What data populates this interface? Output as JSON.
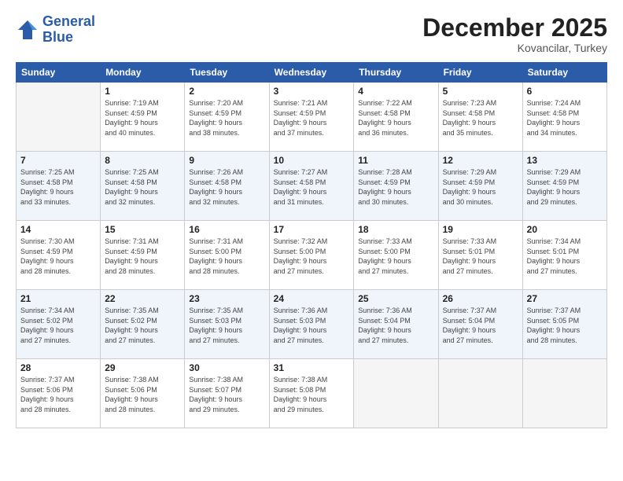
{
  "logo": {
    "line1": "General",
    "line2": "Blue"
  },
  "title": "December 2025",
  "location": "Kovancilar, Turkey",
  "headers": [
    "Sunday",
    "Monday",
    "Tuesday",
    "Wednesday",
    "Thursday",
    "Friday",
    "Saturday"
  ],
  "weeks": [
    [
      {
        "day": "",
        "info": ""
      },
      {
        "day": "1",
        "info": "Sunrise: 7:19 AM\nSunset: 4:59 PM\nDaylight: 9 hours\nand 40 minutes."
      },
      {
        "day": "2",
        "info": "Sunrise: 7:20 AM\nSunset: 4:59 PM\nDaylight: 9 hours\nand 38 minutes."
      },
      {
        "day": "3",
        "info": "Sunrise: 7:21 AM\nSunset: 4:59 PM\nDaylight: 9 hours\nand 37 minutes."
      },
      {
        "day": "4",
        "info": "Sunrise: 7:22 AM\nSunset: 4:58 PM\nDaylight: 9 hours\nand 36 minutes."
      },
      {
        "day": "5",
        "info": "Sunrise: 7:23 AM\nSunset: 4:58 PM\nDaylight: 9 hours\nand 35 minutes."
      },
      {
        "day": "6",
        "info": "Sunrise: 7:24 AM\nSunset: 4:58 PM\nDaylight: 9 hours\nand 34 minutes."
      }
    ],
    [
      {
        "day": "7",
        "info": "Sunrise: 7:25 AM\nSunset: 4:58 PM\nDaylight: 9 hours\nand 33 minutes."
      },
      {
        "day": "8",
        "info": "Sunrise: 7:25 AM\nSunset: 4:58 PM\nDaylight: 9 hours\nand 32 minutes."
      },
      {
        "day": "9",
        "info": "Sunrise: 7:26 AM\nSunset: 4:58 PM\nDaylight: 9 hours\nand 32 minutes."
      },
      {
        "day": "10",
        "info": "Sunrise: 7:27 AM\nSunset: 4:58 PM\nDaylight: 9 hours\nand 31 minutes."
      },
      {
        "day": "11",
        "info": "Sunrise: 7:28 AM\nSunset: 4:59 PM\nDaylight: 9 hours\nand 30 minutes."
      },
      {
        "day": "12",
        "info": "Sunrise: 7:29 AM\nSunset: 4:59 PM\nDaylight: 9 hours\nand 30 minutes."
      },
      {
        "day": "13",
        "info": "Sunrise: 7:29 AM\nSunset: 4:59 PM\nDaylight: 9 hours\nand 29 minutes."
      }
    ],
    [
      {
        "day": "14",
        "info": "Sunrise: 7:30 AM\nSunset: 4:59 PM\nDaylight: 9 hours\nand 28 minutes."
      },
      {
        "day": "15",
        "info": "Sunrise: 7:31 AM\nSunset: 4:59 PM\nDaylight: 9 hours\nand 28 minutes."
      },
      {
        "day": "16",
        "info": "Sunrise: 7:31 AM\nSunset: 5:00 PM\nDaylight: 9 hours\nand 28 minutes."
      },
      {
        "day": "17",
        "info": "Sunrise: 7:32 AM\nSunset: 5:00 PM\nDaylight: 9 hours\nand 27 minutes."
      },
      {
        "day": "18",
        "info": "Sunrise: 7:33 AM\nSunset: 5:00 PM\nDaylight: 9 hours\nand 27 minutes."
      },
      {
        "day": "19",
        "info": "Sunrise: 7:33 AM\nSunset: 5:01 PM\nDaylight: 9 hours\nand 27 minutes."
      },
      {
        "day": "20",
        "info": "Sunrise: 7:34 AM\nSunset: 5:01 PM\nDaylight: 9 hours\nand 27 minutes."
      }
    ],
    [
      {
        "day": "21",
        "info": "Sunrise: 7:34 AM\nSunset: 5:02 PM\nDaylight: 9 hours\nand 27 minutes."
      },
      {
        "day": "22",
        "info": "Sunrise: 7:35 AM\nSunset: 5:02 PM\nDaylight: 9 hours\nand 27 minutes."
      },
      {
        "day": "23",
        "info": "Sunrise: 7:35 AM\nSunset: 5:03 PM\nDaylight: 9 hours\nand 27 minutes."
      },
      {
        "day": "24",
        "info": "Sunrise: 7:36 AM\nSunset: 5:03 PM\nDaylight: 9 hours\nand 27 minutes."
      },
      {
        "day": "25",
        "info": "Sunrise: 7:36 AM\nSunset: 5:04 PM\nDaylight: 9 hours\nand 27 minutes."
      },
      {
        "day": "26",
        "info": "Sunrise: 7:37 AM\nSunset: 5:04 PM\nDaylight: 9 hours\nand 27 minutes."
      },
      {
        "day": "27",
        "info": "Sunrise: 7:37 AM\nSunset: 5:05 PM\nDaylight: 9 hours\nand 28 minutes."
      }
    ],
    [
      {
        "day": "28",
        "info": "Sunrise: 7:37 AM\nSunset: 5:06 PM\nDaylight: 9 hours\nand 28 minutes."
      },
      {
        "day": "29",
        "info": "Sunrise: 7:38 AM\nSunset: 5:06 PM\nDaylight: 9 hours\nand 28 minutes."
      },
      {
        "day": "30",
        "info": "Sunrise: 7:38 AM\nSunset: 5:07 PM\nDaylight: 9 hours\nand 29 minutes."
      },
      {
        "day": "31",
        "info": "Sunrise: 7:38 AM\nSunset: 5:08 PM\nDaylight: 9 hours\nand 29 minutes."
      },
      {
        "day": "",
        "info": ""
      },
      {
        "day": "",
        "info": ""
      },
      {
        "day": "",
        "info": ""
      }
    ]
  ],
  "row_shaded": [
    false,
    true,
    false,
    true,
    false
  ]
}
